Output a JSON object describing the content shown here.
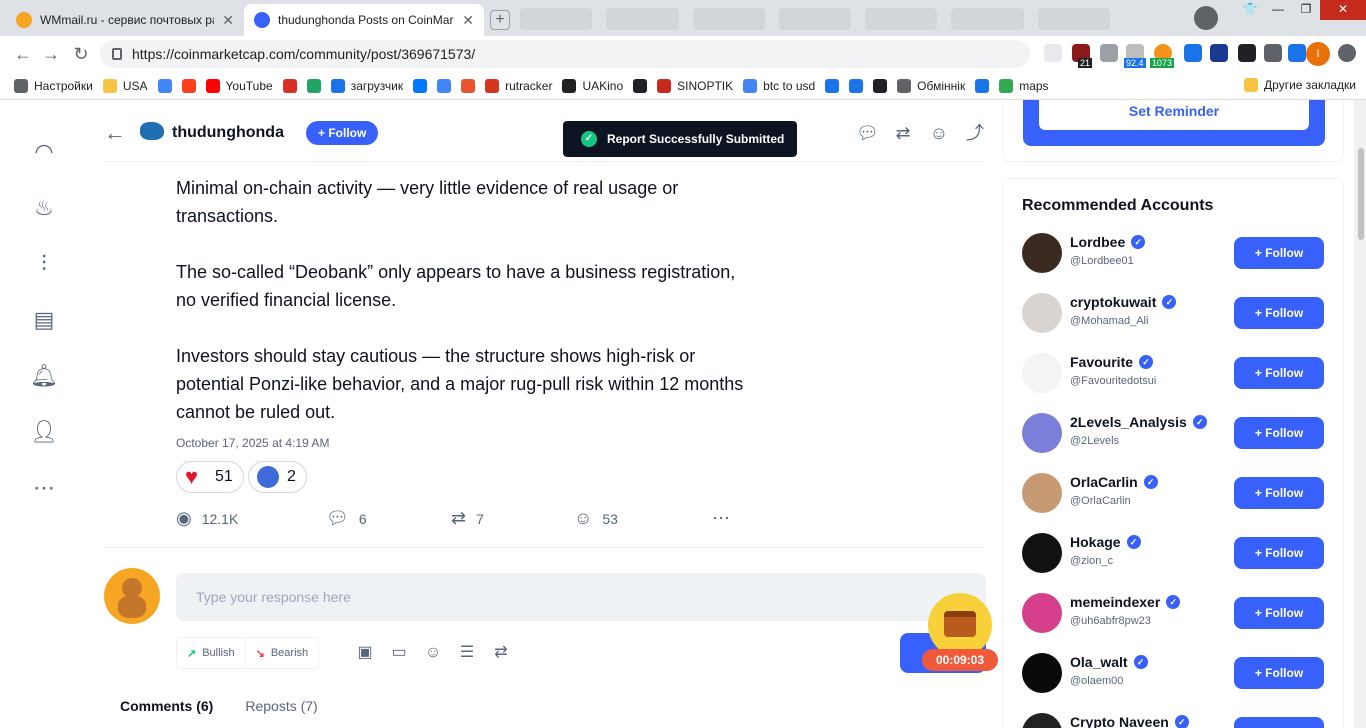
{
  "browser": {
    "tabs": [
      {
        "title": "WMmail.ru - сервис почтовых рассылок",
        "active": false
      },
      {
        "title": "thudunghonda Posts on CoinMarketCap",
        "active": true
      }
    ],
    "url": "https://coinmarketcap.com/community/post/369671573/",
    "extension_badges": {
      "b1": "21",
      "b2": "92.4",
      "b3": "1073"
    },
    "profile_initial": "I",
    "bookmarks": [
      {
        "label": "Настройки",
        "icon": "gear-icon",
        "color": "#5f6368"
      },
      {
        "label": "USA",
        "icon": "folder-icon",
        "color": "#f6c343"
      },
      {
        "label": "",
        "icon": "google-icon",
        "color": "#4285f4"
      },
      {
        "label": "",
        "icon": "yandex-icon",
        "color": "#fc3f1d"
      },
      {
        "label": "YouTube",
        "icon": "youtube-icon",
        "color": "#ff0000"
      },
      {
        "label": "",
        "icon": "gmail-icon",
        "color": "#d93025"
      },
      {
        "label": "",
        "icon": "drive-icon",
        "color": "#1fa463"
      },
      {
        "label": "загрузчик",
        "icon": "link-icon",
        "color": "#1a73e8"
      },
      {
        "label": "",
        "icon": "vk-icon",
        "color": "#0077ff"
      },
      {
        "label": "",
        "icon": "translate-icon",
        "color": "#4285f4"
      },
      {
        "label": "",
        "icon": "f-icon",
        "color": "#e8542f"
      },
      {
        "label": "rutracker",
        "icon": "rutracker-icon",
        "color": "#d4351c"
      },
      {
        "label": "UAKino",
        "icon": "film-icon",
        "color": "#202124"
      },
      {
        "label": "",
        "icon": "person-icon",
        "color": "#202124"
      },
      {
        "label": "SINOPTIK",
        "icon": "thermometer-icon",
        "color": "#c42b1c"
      },
      {
        "label": "btc to usd",
        "icon": "google-icon",
        "color": "#4285f4"
      },
      {
        "label": "",
        "icon": "p-icon",
        "color": "#1a73e8"
      },
      {
        "label": "",
        "icon": "arrow-icon",
        "color": "#1a73e8"
      },
      {
        "label": "",
        "icon": "bc-icon",
        "color": "#202124"
      },
      {
        "label": "Обміннік",
        "icon": "exchange-icon",
        "color": "#5f6368"
      },
      {
        "label": "",
        "icon": "star-icon",
        "color": "#1a73e8"
      },
      {
        "label": "maps",
        "icon": "maps-icon",
        "color": "#34a853"
      }
    ],
    "other_bookmarks": "Другие закладки"
  },
  "header": {
    "author": "thudunghonda",
    "follow_label": "Follow"
  },
  "toast": {
    "message": "Report Successfully Submitted"
  },
  "post": {
    "paragraphs": [
      "Minimal on-chain activity — very little evidence of real usage or transactions.",
      "The so-called “Deobank” only appears to have a business registration, no verified financial license.",
      "Investors should stay cautious — the structure shows high-risk or potential Ponzi-like behavior, and a major rug-pull risk within 12 months cannot be ruled out."
    ],
    "date": "October 17, 2025 at 4:19 AM",
    "reactions": [
      {
        "emoji": "heart-icon",
        "count": "51"
      },
      {
        "emoji": "rocket-emoji-icon",
        "count": "2"
      }
    ],
    "stats": {
      "views": "12.1K",
      "comments": "6",
      "reposts": "7",
      "reactions": "53"
    }
  },
  "composer": {
    "placeholder": "Type your response here",
    "bullish": "Bullish",
    "bearish": "Bearish",
    "timer": "00:09:03"
  },
  "bottom_tabs": {
    "comments": "Comments (6)",
    "reposts": "Reposts (7)"
  },
  "sidebar": {
    "reminder_button": "Set Reminder",
    "recommended_title": "Recommended Accounts",
    "accounts": [
      {
        "name": "Lordbee",
        "handle": "@Lordbee01",
        "color": "#3b2a22"
      },
      {
        "name": "cryptokuwait",
        "handle": "@Mohamad_Ali",
        "color": "#d9d4cf"
      },
      {
        "name": "Favourite",
        "handle": "@Favouritedotsui",
        "color": "#f4f4f4"
      },
      {
        "name": "2Levels_Analysis",
        "handle": "@2Levels",
        "color": "#7c7fd9"
      },
      {
        "name": "OrlaCarlin",
        "handle": "@OrlaCarlin",
        "color": "#c79a73"
      },
      {
        "name": "Hokage",
        "handle": "@zion_c",
        "color": "#111111"
      },
      {
        "name": "memeindexer",
        "handle": "@uh6abfr8pw23",
        "color": "#d63f8c"
      },
      {
        "name": "Ola_walt",
        "handle": "@olaem00",
        "color": "#0a0a0a"
      },
      {
        "name": "Crypto Naveen",
        "handle": "",
        "color": "#222222"
      }
    ],
    "follow_label": "Follow"
  },
  "colors": {
    "accent": "#3861fb",
    "positive": "#16c784",
    "negative": "#ea3943"
  }
}
